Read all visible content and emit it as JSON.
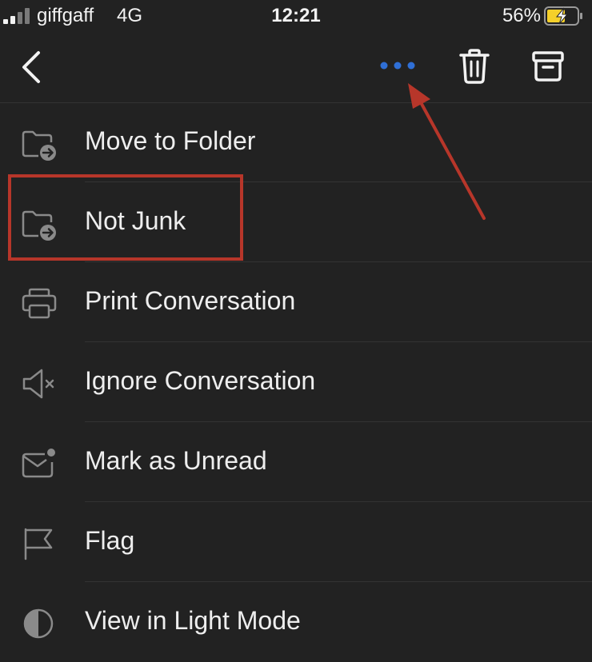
{
  "status_bar": {
    "carrier": "giffgaff",
    "network": "4G",
    "time": "12:21",
    "battery_percent": "56%"
  },
  "nav_bar": {
    "back_icon": "chevron-left-icon",
    "more_icon": "more-horizontal-icon",
    "delete_icon": "trash-icon",
    "archive_icon": "archive-icon"
  },
  "menu": {
    "items": [
      {
        "label": "Move to Folder",
        "icon": "folder-move-icon"
      },
      {
        "label": "Not Junk",
        "icon": "folder-move-icon"
      },
      {
        "label": "Print Conversation",
        "icon": "printer-icon"
      },
      {
        "label": "Ignore Conversation",
        "icon": "speaker-mute-icon"
      },
      {
        "label": "Mark as Unread",
        "icon": "mail-unread-icon"
      },
      {
        "label": "Flag",
        "icon": "flag-icon"
      },
      {
        "label": "View in Light Mode",
        "icon": "half-circle-icon"
      }
    ]
  },
  "colors": {
    "background": "#222222",
    "text": "#eeeeee",
    "icon": "#8a8a8a",
    "accent": "#2f6fd6",
    "annotation": "#b7362a",
    "battery_charge": "#f5d02a"
  }
}
